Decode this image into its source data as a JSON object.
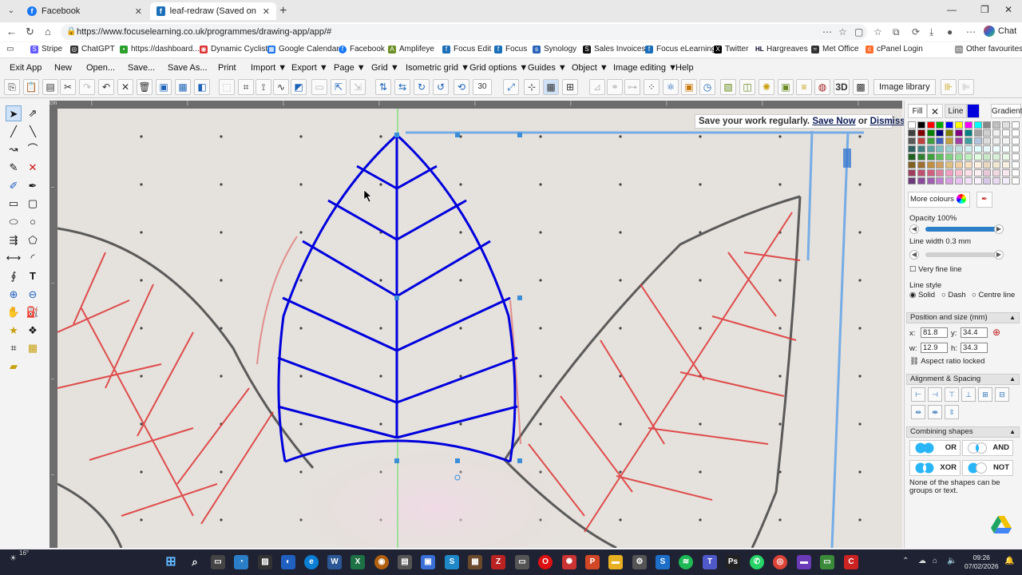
{
  "browser": {
    "tabs": [
      {
        "label": "Facebook",
        "active": false
      },
      {
        "label": "leaf-redraw (Saved on Focus eLear",
        "active": true
      }
    ],
    "url": "https://www.focuselearning.co.uk/programmes/drawing-app/app/#",
    "chat_label": "Chat"
  },
  "bookmarks": [
    "Stripe",
    "ChatGPT",
    "https://dashboard....",
    "Dynamic Cyclist",
    "Google Calendar",
    "Facebook",
    "Amplifeye",
    "Focus Edit",
    "Focus",
    "Synology",
    "Sales Invoices",
    "Focus eLearning",
    "Twitter",
    "Hargreaves",
    "Met Office",
    "cPanel Login"
  ],
  "bookmarks_other": "Other favourites",
  "menu": {
    "exit": "Exit App",
    "new": "New",
    "open": "Open...",
    "save": "Save...",
    "save_as": "Save As...",
    "print": "Print",
    "import": "Import ▼",
    "export": "Export ▼",
    "page": "Page ▼",
    "grid": "Grid ▼",
    "iso_grid": "Isometric grid ▼",
    "grid_options": "Grid options ▼",
    "guides": "Guides ▼",
    "object": "Object ▼",
    "image_editing": "Image editing ▼",
    "help": "Help"
  },
  "toolbar": {
    "zoom_value": "30",
    "image_library": "Image library"
  },
  "banner": {
    "text": "Save your work regularly.",
    "save_now": "Save Now",
    "or": "or",
    "dismiss": "Dismiss"
  },
  "panel": {
    "fill_tab": "Fill",
    "line_tab": "Line",
    "gradient_tab": "Gradient",
    "more_colours": "More colours",
    "opacity_label": "Opacity 100%",
    "opacity_level": 100,
    "line_width_label": "Line width 0.3 mm",
    "very_fine_line": "Very fine line",
    "line_style_label": "Line style",
    "line_styles": [
      "Solid",
      "Dash",
      "Centre line"
    ],
    "position_section": "Position and size (mm)",
    "x_label": "x:",
    "x_value": "81.8",
    "y_label": "y:",
    "y_value": "34.4",
    "w_label": "w:",
    "w_value": "12.9",
    "h_label": "h:",
    "h_value": "34.3",
    "aspect_label": "Aspect ratio locked",
    "alignment_section": "Alignment & Spacing",
    "combining_section": "Combining shapes",
    "combine_ops": [
      "OR",
      "AND",
      "XOR",
      "NOT"
    ],
    "combine_note": "None of the shapes can be groups or text.",
    "accent_color": "#0000dd",
    "palette_colors": [
      "#ffffff",
      "#000000",
      "#ff0000",
      "#00aa00",
      "#0000ff",
      "#ffff00",
      "#ff00ff",
      "#00ffff",
      "#888888",
      "#c0c0c0",
      "#e0e0e0",
      "#ffffff",
      "#404040",
      "#800000",
      "#008000",
      "#000080",
      "#808000",
      "#800080",
      "#008080",
      "#a0a0a0",
      "#d0d0d0",
      "#f0f0f0",
      "#fafafa",
      "#ffffff",
      "#5a5a5a",
      "#c04040",
      "#40a040",
      "#4060c0",
      "#c0a040",
      "#a040a0",
      "#40a0a0",
      "#b0c4de",
      "#dcdcdc",
      "#eeeeee",
      "#f5f5f5",
      "#ffffff",
      "#306060",
      "#408080",
      "#60a0a0",
      "#80c0c0",
      "#a0d0d0",
      "#c0e0e0",
      "#d0f0f0",
      "#e0ffff",
      "#e8f8f8",
      "#f0ffff",
      "#f8ffff",
      "#ffffff",
      "#206020",
      "#308030",
      "#40a040",
      "#60c060",
      "#80d080",
      "#a0e0a0",
      "#c0f0c0",
      "#e0ffe0",
      "#c8e8c8",
      "#d8f0d8",
      "#e8f8e8",
      "#ffffff",
      "#806020",
      "#a07030",
      "#c09040",
      "#d0a060",
      "#e0c080",
      "#f0d0a0",
      "#f8e0c0",
      "#fff0e0",
      "#e8d8c0",
      "#f0e8d0",
      "#f8f0e0",
      "#ffffff",
      "#a04060",
      "#c05070",
      "#d06080",
      "#e080a0",
      "#f0a0c0",
      "#f8c0d0",
      "#ffe0e8",
      "#fff0f4",
      "#e8c8d8",
      "#f0d8e0",
      "#f8e8f0",
      "#ffffff",
      "#6b3a7a",
      "#8b4a9a",
      "#a060b0",
      "#c080d0",
      "#d8a0e0",
      "#e8c0f0",
      "#f4e0fa",
      "#faf0ff",
      "#d8c8e8",
      "#e8d8f0",
      "#f4ecfa",
      "#ffffff"
    ]
  },
  "taskbar": {
    "temp": "16°",
    "time": "09:26",
    "date": "07/02/2026"
  }
}
